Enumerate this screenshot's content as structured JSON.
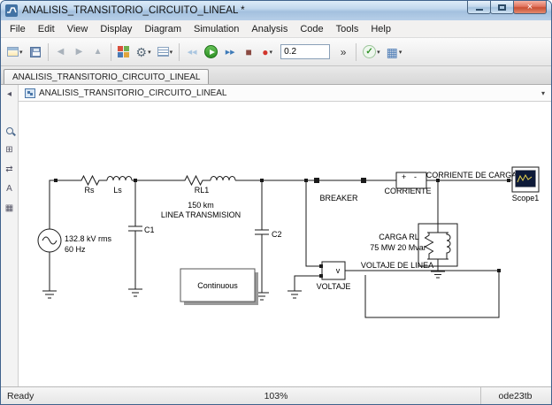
{
  "window": {
    "title": "ANALISIS_TRANSITORIO_CIRCUITO_LINEAL *",
    "close_glyph": "×"
  },
  "menu": {
    "items": [
      "File",
      "Edit",
      "View",
      "Display",
      "Diagram",
      "Simulation",
      "Analysis",
      "Code",
      "Tools",
      "Help"
    ]
  },
  "glyphs": {
    "dropdown": "▾",
    "back": "◀",
    "forward": "▶",
    "up": "▲",
    "gear": "⚙",
    "step_back": "◀◀",
    "step_forward": "▶▶",
    "stop": "■",
    "record": "●",
    "chevrons": "»",
    "check": "✓",
    "build": "▦",
    "collapse_left": "◂",
    "fit": "⊞",
    "swap": "⇄",
    "annotation": "A",
    "sample": "▦"
  },
  "toolbar": {
    "stop_time": "0.2"
  },
  "tab": {
    "label": "ANALISIS_TRANSITORIO_CIRCUITO_LINEAL"
  },
  "breadcrumb": {
    "label": "ANALISIS_TRANSITORIO_CIRCUITO_LINEAL"
  },
  "statusbar": {
    "status": "Ready",
    "zoom": "103%",
    "solver": "ode23tb"
  },
  "diagram": {
    "labels": {
      "source_line1": "132.8 kV rms",
      "source_line2": "60 Hz",
      "rs": "Rs",
      "ls": "Ls",
      "rl1": "RL1",
      "line_km": "150 km",
      "line_name": "LINEA TRANSMISION",
      "c1": "C1",
      "c2": "C2",
      "breaker": "BREAKER",
      "corriente": "CORRIENTE",
      "corriente_carga": "CORRIENTE DE CARGA",
      "scope": "Scope1",
      "carga_rl": "CARGA RL",
      "carga_power": "75 MW 20 Mvar",
      "voltaje": "VOLTAJE",
      "voltaje_linea": "VOLTAJE DE LINEA",
      "powergui": "Continuous",
      "voltmeter_v": "v",
      "ammeter_plus": "+",
      "ammeter_minus": "-"
    }
  }
}
